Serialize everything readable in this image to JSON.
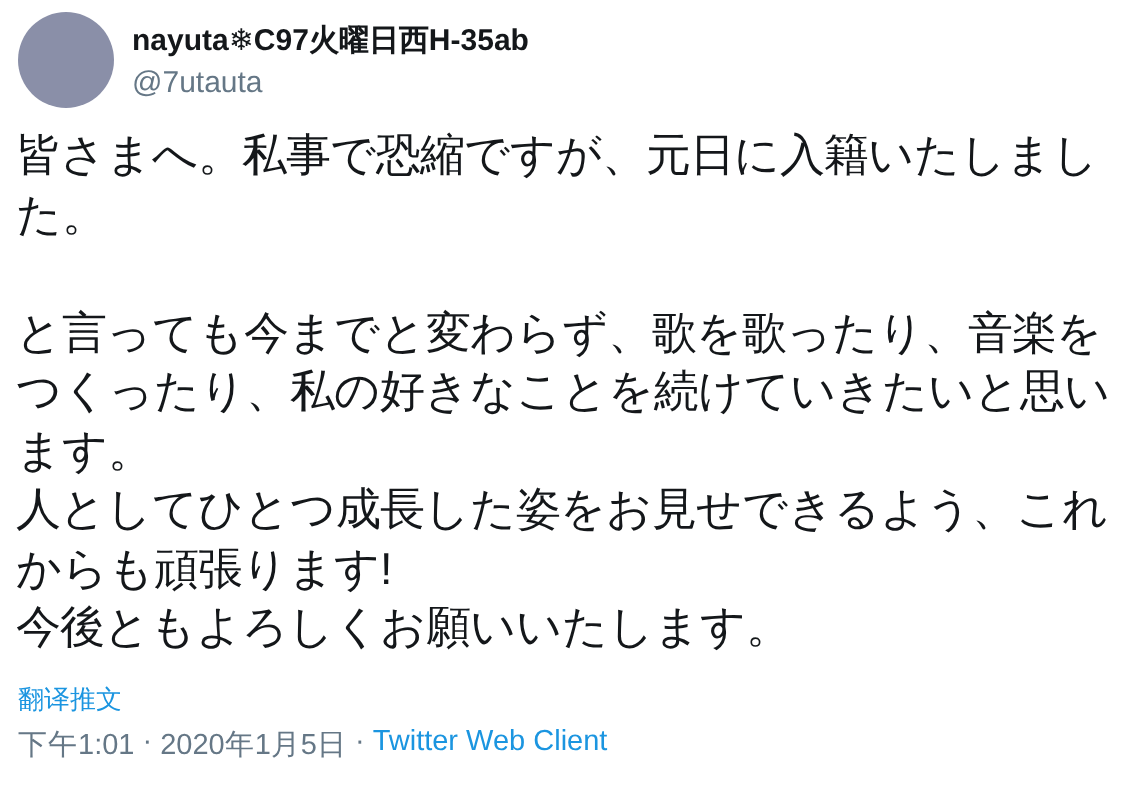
{
  "author": {
    "name": "nayuta❄C97火曜日西H-35ab",
    "handle": "@7utauta"
  },
  "body": [
    {
      "lines": [
        "皆さまへ。私事で恐縮ですが、元日に入籍いたしました。"
      ]
    },
    {
      "lines": [
        "と言っても今までと変わらず、歌を歌ったり、音楽をつくったり、私の好きなことを続けていきたいと思います。",
        "人としてひとつ成長した姿をお見せできるよう、これからも頑張ります!",
        "今後ともよろしくお願いいたします。"
      ]
    }
  ],
  "translate_link": "翻译推文",
  "meta": {
    "time": "下午1:01",
    "separator_1": "·",
    "date": "2020年1月5日",
    "separator_2": "·",
    "client": "Twitter Web Client"
  }
}
